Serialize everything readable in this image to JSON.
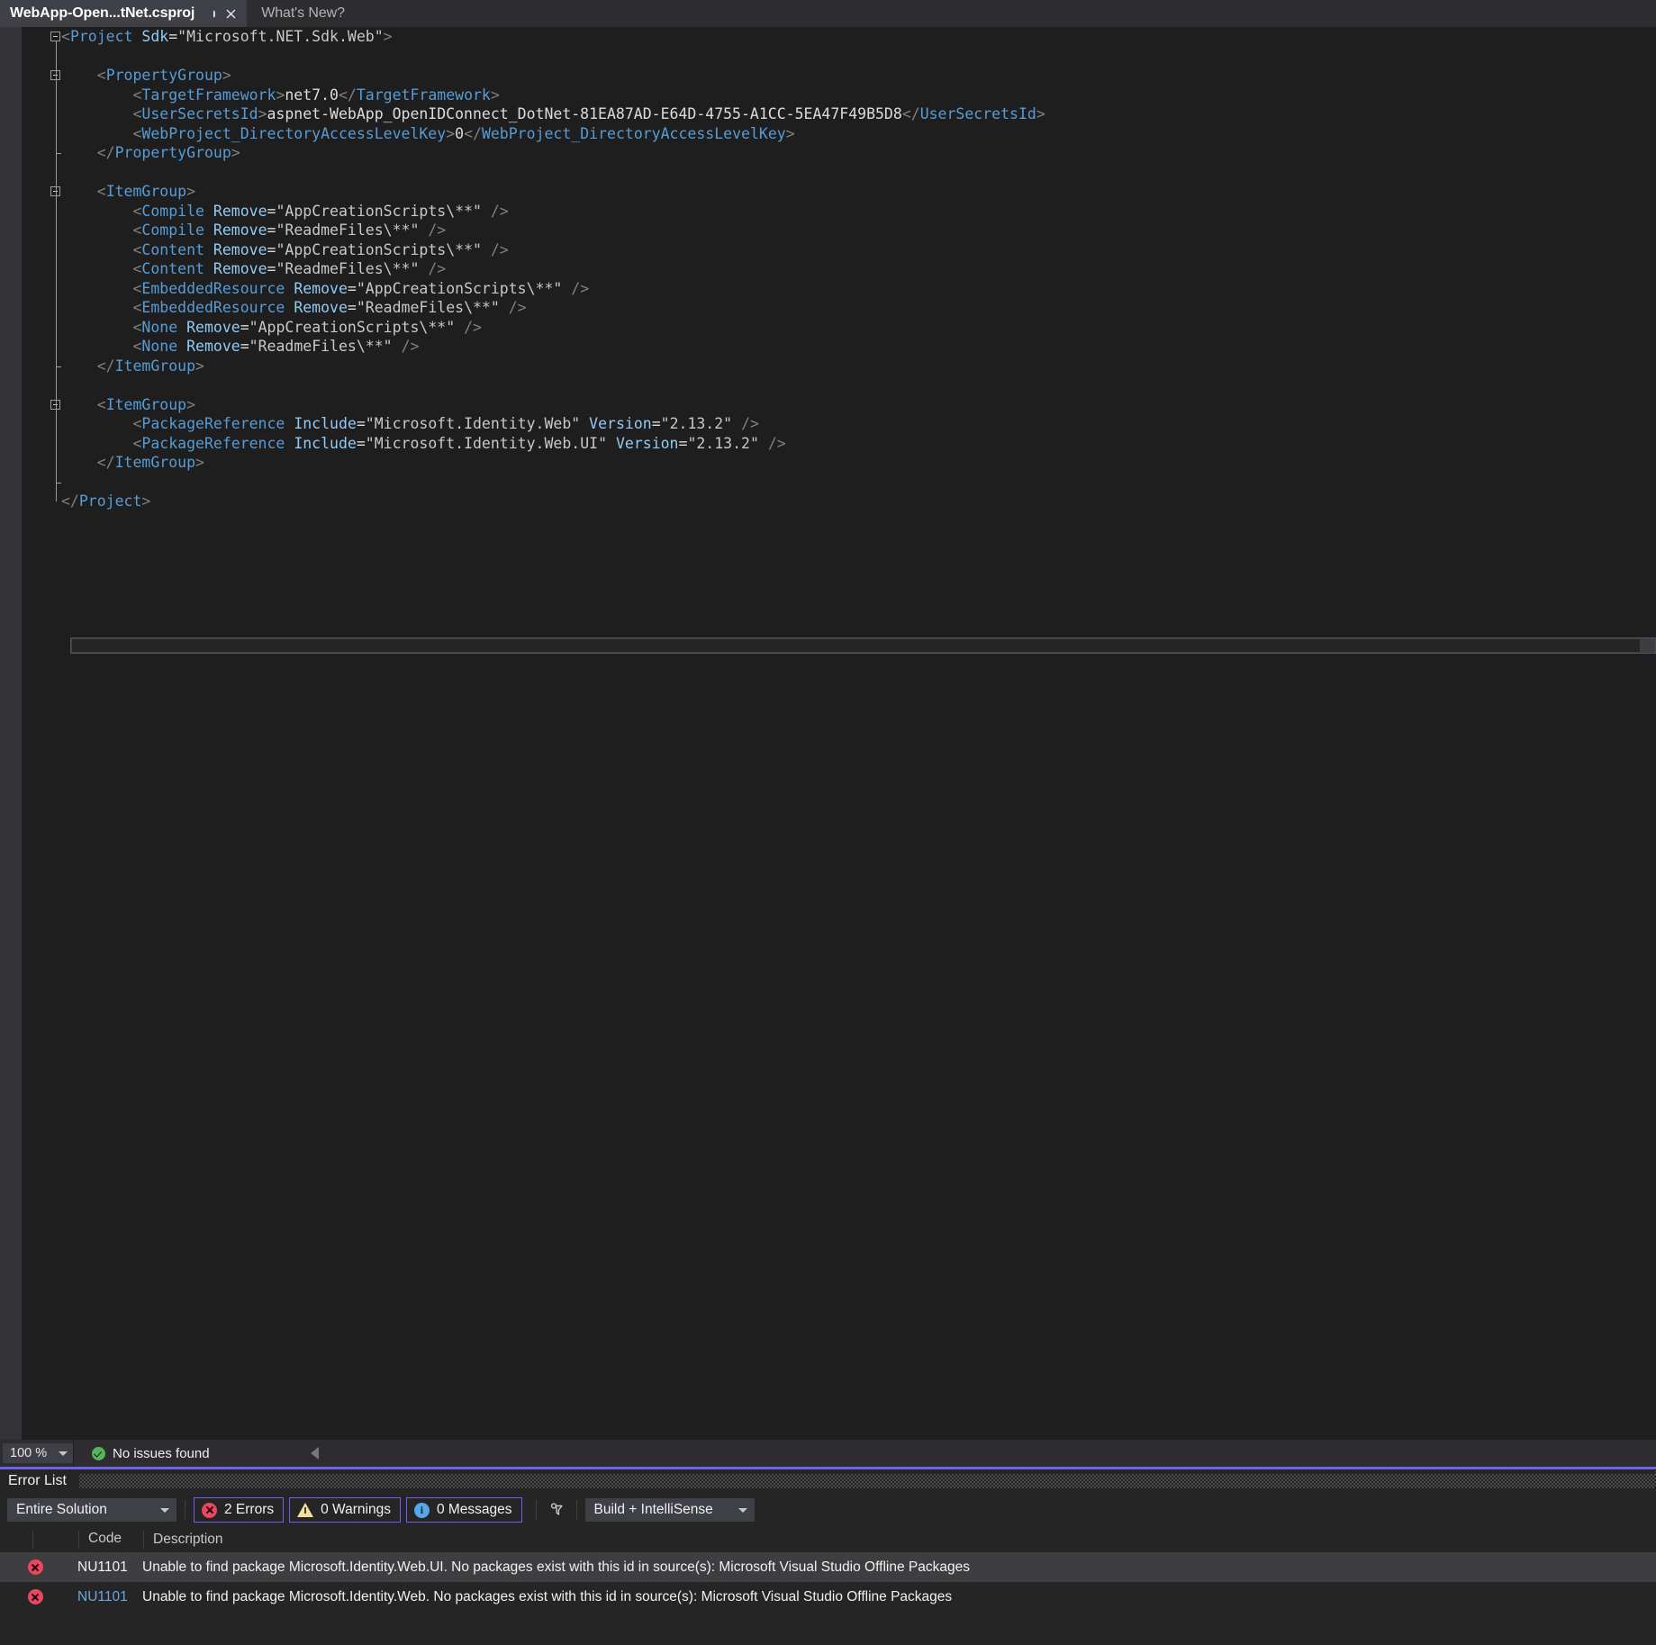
{
  "tabs": [
    {
      "label": "WebApp-Open...tNet.csproj",
      "active": true,
      "pin_icon": "pin-icon",
      "close_icon": "close-icon"
    },
    {
      "label": "What's New?",
      "active": false
    }
  ],
  "editor": {
    "language": "xml",
    "lines": [
      {
        "indent": 0,
        "fold": true,
        "tokens": [
          {
            "t": "punc",
            "v": "<"
          },
          {
            "t": "tag",
            "v": "Project"
          },
          {
            "t": "sp",
            "v": " "
          },
          {
            "t": "attr",
            "v": "Sdk"
          },
          {
            "t": "eq",
            "v": "="
          },
          {
            "t": "val",
            "v": "\"Microsoft.NET.Sdk.Web\""
          },
          {
            "t": "punc",
            "v": ">"
          }
        ]
      },
      {
        "indent": 0,
        "fold": false,
        "tokens": []
      },
      {
        "indent": 1,
        "fold": true,
        "tokens": [
          {
            "t": "punc",
            "v": "<"
          },
          {
            "t": "tag",
            "v": "PropertyGroup"
          },
          {
            "t": "punc",
            "v": ">"
          }
        ]
      },
      {
        "indent": 2,
        "fold": false,
        "tokens": [
          {
            "t": "punc",
            "v": "<"
          },
          {
            "t": "tag",
            "v": "TargetFramework"
          },
          {
            "t": "punc",
            "v": ">"
          },
          {
            "t": "txt",
            "v": "net7.0"
          },
          {
            "t": "punc",
            "v": "</"
          },
          {
            "t": "tag",
            "v": "TargetFramework"
          },
          {
            "t": "punc",
            "v": ">"
          }
        ]
      },
      {
        "indent": 2,
        "fold": false,
        "tokens": [
          {
            "t": "punc",
            "v": "<"
          },
          {
            "t": "tag",
            "v": "UserSecretsId"
          },
          {
            "t": "punc",
            "v": ">"
          },
          {
            "t": "txt",
            "v": "aspnet-WebApp_OpenIDConnect_DotNet-81EA87AD-E64D-4755-A1CC-5EA47F49B5D8"
          },
          {
            "t": "punc",
            "v": "</"
          },
          {
            "t": "tag",
            "v": "UserSecretsId"
          },
          {
            "t": "punc",
            "v": ">"
          }
        ]
      },
      {
        "indent": 2,
        "fold": false,
        "tokens": [
          {
            "t": "punc",
            "v": "<"
          },
          {
            "t": "tag",
            "v": "WebProject_DirectoryAccessLevelKey"
          },
          {
            "t": "punc",
            "v": ">"
          },
          {
            "t": "txt",
            "v": "0"
          },
          {
            "t": "punc",
            "v": "</"
          },
          {
            "t": "tag",
            "v": "WebProject_DirectoryAccessLevelKey"
          },
          {
            "t": "punc",
            "v": ">"
          }
        ]
      },
      {
        "indent": 1,
        "fold": false,
        "tokens": [
          {
            "t": "punc",
            "v": "</"
          },
          {
            "t": "tag",
            "v": "PropertyGroup"
          },
          {
            "t": "punc",
            "v": ">"
          }
        ]
      },
      {
        "indent": 0,
        "fold": false,
        "tokens": []
      },
      {
        "indent": 1,
        "fold": true,
        "tokens": [
          {
            "t": "punc",
            "v": "<"
          },
          {
            "t": "tag",
            "v": "ItemGroup"
          },
          {
            "t": "punc",
            "v": ">"
          }
        ]
      },
      {
        "indent": 2,
        "fold": false,
        "tokens": [
          {
            "t": "punc",
            "v": "<"
          },
          {
            "t": "tag",
            "v": "Compile"
          },
          {
            "t": "sp",
            "v": " "
          },
          {
            "t": "attr",
            "v": "Remove"
          },
          {
            "t": "eq",
            "v": "="
          },
          {
            "t": "val",
            "v": "\"AppCreationScripts\\**\""
          },
          {
            "t": "sp",
            "v": " "
          },
          {
            "t": "punc",
            "v": "/>"
          }
        ]
      },
      {
        "indent": 2,
        "fold": false,
        "tokens": [
          {
            "t": "punc",
            "v": "<"
          },
          {
            "t": "tag",
            "v": "Compile"
          },
          {
            "t": "sp",
            "v": " "
          },
          {
            "t": "attr",
            "v": "Remove"
          },
          {
            "t": "eq",
            "v": "="
          },
          {
            "t": "val",
            "v": "\"ReadmeFiles\\**\""
          },
          {
            "t": "sp",
            "v": " "
          },
          {
            "t": "punc",
            "v": "/>"
          }
        ]
      },
      {
        "indent": 2,
        "fold": false,
        "tokens": [
          {
            "t": "punc",
            "v": "<"
          },
          {
            "t": "tag",
            "v": "Content"
          },
          {
            "t": "sp",
            "v": " "
          },
          {
            "t": "attr",
            "v": "Remove"
          },
          {
            "t": "eq",
            "v": "="
          },
          {
            "t": "val",
            "v": "\"AppCreationScripts\\**\""
          },
          {
            "t": "sp",
            "v": " "
          },
          {
            "t": "punc",
            "v": "/>"
          }
        ]
      },
      {
        "indent": 2,
        "fold": false,
        "tokens": [
          {
            "t": "punc",
            "v": "<"
          },
          {
            "t": "tag",
            "v": "Content"
          },
          {
            "t": "sp",
            "v": " "
          },
          {
            "t": "attr",
            "v": "Remove"
          },
          {
            "t": "eq",
            "v": "="
          },
          {
            "t": "val",
            "v": "\"ReadmeFiles\\**\""
          },
          {
            "t": "sp",
            "v": " "
          },
          {
            "t": "punc",
            "v": "/>"
          }
        ]
      },
      {
        "indent": 2,
        "fold": false,
        "tokens": [
          {
            "t": "punc",
            "v": "<"
          },
          {
            "t": "tag",
            "v": "EmbeddedResource"
          },
          {
            "t": "sp",
            "v": " "
          },
          {
            "t": "attr",
            "v": "Remove"
          },
          {
            "t": "eq",
            "v": "="
          },
          {
            "t": "val",
            "v": "\"AppCreationScripts\\**\""
          },
          {
            "t": "sp",
            "v": " "
          },
          {
            "t": "punc",
            "v": "/>"
          }
        ]
      },
      {
        "indent": 2,
        "fold": false,
        "tokens": [
          {
            "t": "punc",
            "v": "<"
          },
          {
            "t": "tag",
            "v": "EmbeddedResource"
          },
          {
            "t": "sp",
            "v": " "
          },
          {
            "t": "attr",
            "v": "Remove"
          },
          {
            "t": "eq",
            "v": "="
          },
          {
            "t": "val",
            "v": "\"ReadmeFiles\\**\""
          },
          {
            "t": "sp",
            "v": " "
          },
          {
            "t": "punc",
            "v": "/>"
          }
        ]
      },
      {
        "indent": 2,
        "fold": false,
        "tokens": [
          {
            "t": "punc",
            "v": "<"
          },
          {
            "t": "tag",
            "v": "None"
          },
          {
            "t": "sp",
            "v": " "
          },
          {
            "t": "attr",
            "v": "Remove"
          },
          {
            "t": "eq",
            "v": "="
          },
          {
            "t": "val",
            "v": "\"AppCreationScripts\\**\""
          },
          {
            "t": "sp",
            "v": " "
          },
          {
            "t": "punc",
            "v": "/>"
          }
        ]
      },
      {
        "indent": 2,
        "fold": false,
        "tokens": [
          {
            "t": "punc",
            "v": "<"
          },
          {
            "t": "tag",
            "v": "None"
          },
          {
            "t": "sp",
            "v": " "
          },
          {
            "t": "attr",
            "v": "Remove"
          },
          {
            "t": "eq",
            "v": "="
          },
          {
            "t": "val",
            "v": "\"ReadmeFiles\\**\""
          },
          {
            "t": "sp",
            "v": " "
          },
          {
            "t": "punc",
            "v": "/>"
          }
        ]
      },
      {
        "indent": 1,
        "fold": false,
        "tokens": [
          {
            "t": "punc",
            "v": "</"
          },
          {
            "t": "tag",
            "v": "ItemGroup"
          },
          {
            "t": "punc",
            "v": ">"
          }
        ]
      },
      {
        "indent": 0,
        "fold": false,
        "tokens": []
      },
      {
        "indent": 1,
        "fold": true,
        "tokens": [
          {
            "t": "punc",
            "v": "<"
          },
          {
            "t": "tag",
            "v": "ItemGroup"
          },
          {
            "t": "punc",
            "v": ">"
          }
        ]
      },
      {
        "indent": 2,
        "fold": false,
        "tokens": [
          {
            "t": "punc",
            "v": "<"
          },
          {
            "t": "tag",
            "v": "PackageReference"
          },
          {
            "t": "sp",
            "v": " "
          },
          {
            "t": "attr",
            "v": "Include"
          },
          {
            "t": "eq",
            "v": "="
          },
          {
            "t": "val",
            "v": "\"Microsoft.Identity.Web\""
          },
          {
            "t": "sp",
            "v": " "
          },
          {
            "t": "attr",
            "v": "Version"
          },
          {
            "t": "eq",
            "v": "="
          },
          {
            "t": "val",
            "v": "\"2.13.2\""
          },
          {
            "t": "sp",
            "v": " "
          },
          {
            "t": "punc",
            "v": "/>"
          }
        ]
      },
      {
        "indent": 2,
        "fold": false,
        "tokens": [
          {
            "t": "punc",
            "v": "<"
          },
          {
            "t": "tag",
            "v": "PackageReference"
          },
          {
            "t": "sp",
            "v": " "
          },
          {
            "t": "attr",
            "v": "Include"
          },
          {
            "t": "eq",
            "v": "="
          },
          {
            "t": "val",
            "v": "\"Microsoft.Identity.Web.UI\""
          },
          {
            "t": "sp",
            "v": " "
          },
          {
            "t": "attr",
            "v": "Version"
          },
          {
            "t": "eq",
            "v": "="
          },
          {
            "t": "val",
            "v": "\"2.13.2\""
          },
          {
            "t": "sp",
            "v": " "
          },
          {
            "t": "punc",
            "v": "/>"
          }
        ]
      },
      {
        "indent": 1,
        "fold": false,
        "tokens": [
          {
            "t": "punc",
            "v": "</"
          },
          {
            "t": "tag",
            "v": "ItemGroup"
          },
          {
            "t": "punc",
            "v": ">"
          }
        ]
      },
      {
        "indent": 0,
        "fold": false,
        "tokens": []
      },
      {
        "indent": 0,
        "fold": false,
        "tokens": [
          {
            "t": "punc",
            "v": "</"
          },
          {
            "t": "tag",
            "v": "Project"
          },
          {
            "t": "punc",
            "v": ">"
          }
        ]
      }
    ]
  },
  "status_bar": {
    "zoom_level": "100 %",
    "zoom_caret_icon": "chevron-down-icon",
    "issues_icon": "check-circle-icon",
    "issues_text": "No issues found",
    "nav_back_icon": "triangle-left-icon"
  },
  "error_list": {
    "title": "Error List",
    "scope_filter": "Entire Solution",
    "scope_caret_icon": "chevron-down-icon",
    "counts": [
      {
        "icon": "error-icon",
        "label": "2 Errors",
        "active": true
      },
      {
        "icon": "warning-icon",
        "label": "0 Warnings",
        "active": true
      },
      {
        "icon": "info-icon",
        "label": "0 Messages",
        "active": true
      }
    ],
    "filter_icon": "funnel-icon",
    "source_filter": "Build + IntelliSense",
    "source_caret_icon": "chevron-down-icon",
    "columns": [
      "Code",
      "Description"
    ],
    "rows": [
      {
        "icon": "error-icon",
        "code": "NU1101",
        "description": "Unable to find package Microsoft.Identity.Web.UI. No packages exist with this id in source(s): Microsoft Visual Studio Offline Packages",
        "selected": true
      },
      {
        "icon": "error-icon",
        "code": "NU1101",
        "description": "Unable to find package Microsoft.Identity.Web. No packages exist with this id in source(s): Microsoft Visual Studio Offline Packages",
        "selected": false
      }
    ]
  },
  "colors": {
    "accent": "#7160e8",
    "error": "#e8495f",
    "warning": "#f3dfa0",
    "info": "#55a8e8",
    "ok": "#57b45c",
    "xml_tag": "#569cd6",
    "xml_attr": "#92caf4",
    "editor_bg": "#1e1e1e"
  }
}
